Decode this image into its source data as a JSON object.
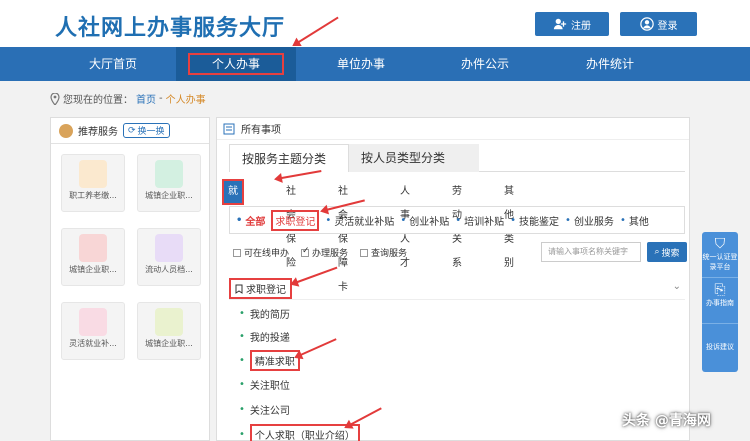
{
  "header": {
    "site_title": "人社网上办事服务大厅",
    "register_label": "注册",
    "login_label": "登录"
  },
  "nav": {
    "items": [
      "大厅首页",
      "个人办事",
      "单位办事",
      "办件公示",
      "办件统计"
    ],
    "active_index": 1
  },
  "breadcrumb": {
    "prefix": "您现在的位置：",
    "home": "首页",
    "separator": " - ",
    "current": "个人办事"
  },
  "left_panel": {
    "title": "推荐服务",
    "switch_label": "换一换",
    "services": [
      {
        "label": "职工养老缴...",
        "icon": "document-user-icon",
        "color": "#e8a23c"
      },
      {
        "label": "城镇企业职...",
        "icon": "person-upload-icon",
        "color": "#3fb37a"
      },
      {
        "label": "城镇企业职...",
        "icon": "card-stack-icon",
        "color": "#e05a5a"
      },
      {
        "label": "流动人员档...",
        "icon": "file-edit-icon",
        "color": "#9b6ad6"
      },
      {
        "label": "灵活就业补...",
        "icon": "monitor-person-icon",
        "color": "#e06a8a"
      },
      {
        "label": "城镇企业职...",
        "icon": "pencil-list-icon",
        "color": "#a6c44a"
      }
    ]
  },
  "main": {
    "header_title": "所有事项",
    "tabs": [
      "按服务主题分类",
      "按人员类型分类"
    ],
    "categories": [
      "就业创业",
      "社会保险",
      "社会保障卡",
      "人事人才",
      "劳动关系",
      "其他类别"
    ],
    "subcategories": [
      "全部",
      "求职登记",
      "灵活就业补贴",
      "创业补贴",
      "培训补贴",
      "技能鉴定",
      "创业服务",
      "其他"
    ],
    "filters": [
      {
        "label": "可在线申办",
        "checked": false
      },
      {
        "label": "办理服务",
        "checked": true
      },
      {
        "label": "查询服务",
        "checked": false
      }
    ],
    "search_placeholder": "请输入事项名称关键字",
    "search_button": "搜索",
    "group_title": "求职登记",
    "items": [
      "我的简历",
      "我的投递",
      "精准求职",
      "关注职位",
      "关注公司",
      "个人求职（职业介绍）"
    ]
  },
  "side_widget": {
    "auth_label": "统一认证登录平台",
    "guide_label": "办事指南",
    "suggest_label": "投诉建议"
  },
  "watermark": "头条 @青海网"
}
